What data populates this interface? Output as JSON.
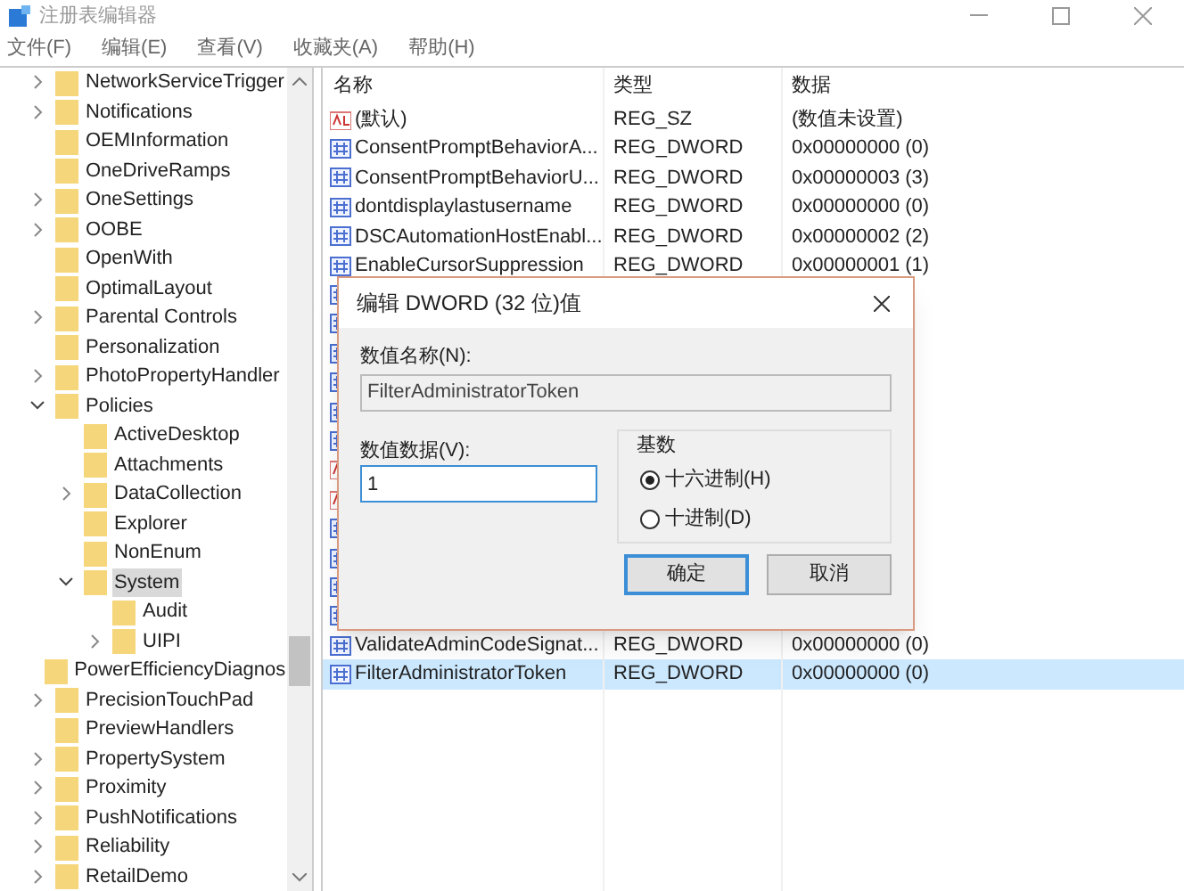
{
  "window": {
    "title": "注册表编辑器"
  },
  "menu": [
    "文件(F)",
    "编辑(E)",
    "查看(V)",
    "收藏夹(A)",
    "帮助(H)"
  ],
  "tree": [
    {
      "label": "NetworkServiceTrigger",
      "kind": "branch",
      "expanded": false,
      "selected": false
    },
    {
      "label": "Notifications",
      "kind": "branch",
      "expanded": false,
      "selected": false
    },
    {
      "label": "OEMInformation",
      "kind": "leaf",
      "selected": false
    },
    {
      "label": "OneDriveRamps",
      "kind": "leaf",
      "selected": false
    },
    {
      "label": "OneSettings",
      "kind": "branch",
      "expanded": false,
      "selected": false
    },
    {
      "label": "OOBE",
      "kind": "branch",
      "expanded": false,
      "selected": false
    },
    {
      "label": "OpenWith",
      "kind": "leaf",
      "selected": false
    },
    {
      "label": "OptimalLayout",
      "kind": "leaf",
      "selected": false
    },
    {
      "label": "Parental Controls",
      "kind": "branch",
      "expanded": false,
      "selected": false
    },
    {
      "label": "Personalization",
      "kind": "leaf",
      "selected": false
    },
    {
      "label": "PhotoPropertyHandler",
      "kind": "branch",
      "expanded": false,
      "selected": false
    },
    {
      "label": "Policies",
      "kind": "branch",
      "expanded": true,
      "selected": false,
      "children": [
        {
          "label": "ActiveDesktop",
          "kind": "leaf",
          "selected": false
        },
        {
          "label": "Attachments",
          "kind": "leaf",
          "selected": false
        },
        {
          "label": "DataCollection",
          "kind": "branch",
          "expanded": false,
          "selected": false
        },
        {
          "label": "Explorer",
          "kind": "leaf",
          "selected": false
        },
        {
          "label": "NonEnum",
          "kind": "leaf",
          "selected": false
        },
        {
          "label": "System",
          "kind": "branch",
          "expanded": true,
          "selected": true,
          "children": [
            {
              "label": "Audit",
              "kind": "leaf",
              "selected": false
            },
            {
              "label": "UIPI",
              "kind": "branch",
              "expanded": false,
              "selected": false
            }
          ]
        }
      ]
    },
    {
      "label": "PowerEfficiencyDiagnos",
      "kind": "leaf",
      "selected": false
    },
    {
      "label": "PrecisionTouchPad",
      "kind": "branch",
      "expanded": false,
      "selected": false
    },
    {
      "label": "PreviewHandlers",
      "kind": "leaf",
      "selected": false
    },
    {
      "label": "PropertySystem",
      "kind": "branch",
      "expanded": false,
      "selected": false
    },
    {
      "label": "Proximity",
      "kind": "branch",
      "expanded": false,
      "selected": false
    },
    {
      "label": "PushNotifications",
      "kind": "branch",
      "expanded": false,
      "selected": false
    },
    {
      "label": "Reliability",
      "kind": "branch",
      "expanded": false,
      "selected": false
    },
    {
      "label": "RetailDemo",
      "kind": "branch",
      "expanded": false,
      "selected": false
    }
  ],
  "list": {
    "columns": [
      "名称",
      "类型",
      "数据"
    ],
    "rows": [
      {
        "kind": "string",
        "name": "(默认)",
        "type": "REG_SZ",
        "data": "(数值未设置)",
        "selected": false
      },
      {
        "kind": "dword",
        "name": "ConsentPromptBehaviorA...",
        "type": "REG_DWORD",
        "data": "0x00000000 (0)",
        "selected": false
      },
      {
        "kind": "dword",
        "name": "ConsentPromptBehaviorU...",
        "type": "REG_DWORD",
        "data": "0x00000003 (3)",
        "selected": false
      },
      {
        "kind": "dword",
        "name": "dontdisplaylastusername",
        "type": "REG_DWORD",
        "data": "0x00000000 (0)",
        "selected": false
      },
      {
        "kind": "dword",
        "name": "DSCAutomationHostEnabl...",
        "type": "REG_DWORD",
        "data": "0x00000002 (2)",
        "selected": false
      },
      {
        "kind": "dword",
        "name": "EnableCursorSuppression",
        "type": "REG_DWORD",
        "data": "0x00000001 (1)",
        "selected": false
      },
      {
        "kind": "dword",
        "selected": false
      },
      {
        "kind": "dword",
        "selected": false
      },
      {
        "kind": "dword",
        "selected": false
      },
      {
        "kind": "dword",
        "selected": false
      },
      {
        "kind": "dword",
        "selected": false
      },
      {
        "kind": "dword",
        "selected": false
      },
      {
        "kind": "string",
        "selected": false
      },
      {
        "kind": "string",
        "selected": false
      },
      {
        "kind": "dword",
        "selected": false
      },
      {
        "kind": "dword",
        "selected": false
      },
      {
        "kind": "dword",
        "selected": false
      },
      {
        "kind": "dword",
        "selected": false
      },
      {
        "kind": "dword",
        "name": "ValidateAdminCodeSignat...",
        "type": "REG_DWORD",
        "data": "0x00000000 (0)",
        "selected": false
      },
      {
        "kind": "dword",
        "name": "FilterAdministratorToken",
        "type": "REG_DWORD",
        "data": "0x00000000 (0)",
        "selected": true
      }
    ]
  },
  "dialog": {
    "title": "编辑 DWORD (32 位)值",
    "name_label": "数值名称(N):",
    "name_value": "FilterAdministratorToken",
    "data_label": "数值数据(V):",
    "data_value": "1",
    "base_label": "基数",
    "bases": [
      {
        "label": "十六进制(H)",
        "selected": true
      },
      {
        "label": "十进制(D)",
        "selected": false
      }
    ],
    "buttons": [
      {
        "label": "确定",
        "default": true
      },
      {
        "label": "取消",
        "default": false
      }
    ]
  }
}
